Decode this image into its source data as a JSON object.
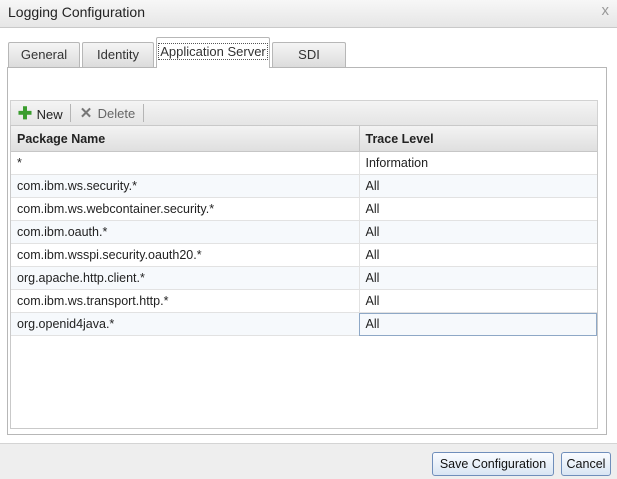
{
  "window": {
    "title": "Logging Configuration",
    "close_glyph": "x"
  },
  "tabs": [
    {
      "label": "General"
    },
    {
      "label": "Identity"
    },
    {
      "label": "Application Server"
    },
    {
      "label": "SDI"
    }
  ],
  "toolbar": {
    "new_label": "New",
    "delete_label": "Delete",
    "new_icon": "plus-icon",
    "delete_icon": "delete-x-icon"
  },
  "table": {
    "columns": [
      "Package Name",
      "Trace Level"
    ],
    "rows": [
      {
        "package": "*",
        "level": "Information"
      },
      {
        "package": "com.ibm.ws.security.*",
        "level": "All"
      },
      {
        "package": "com.ibm.ws.webcontainer.security.*",
        "level": "All"
      },
      {
        "package": "com.ibm.oauth.*",
        "level": "All"
      },
      {
        "package": "com.ibm.wsspi.security.oauth20.*",
        "level": "All"
      },
      {
        "package": "org.apache.http.client.*",
        "level": "All"
      },
      {
        "package": "com.ibm.ws.transport.http.*",
        "level": "All"
      },
      {
        "package": "org.openid4java.*",
        "level": "All"
      }
    ]
  },
  "footer": {
    "save_label": "Save Configuration",
    "cancel_label": "Cancel"
  },
  "colors": {
    "accent_border": "#6f8ebb",
    "new_icon_color": "#3a9d2e",
    "delete_icon_color": "#777777"
  }
}
